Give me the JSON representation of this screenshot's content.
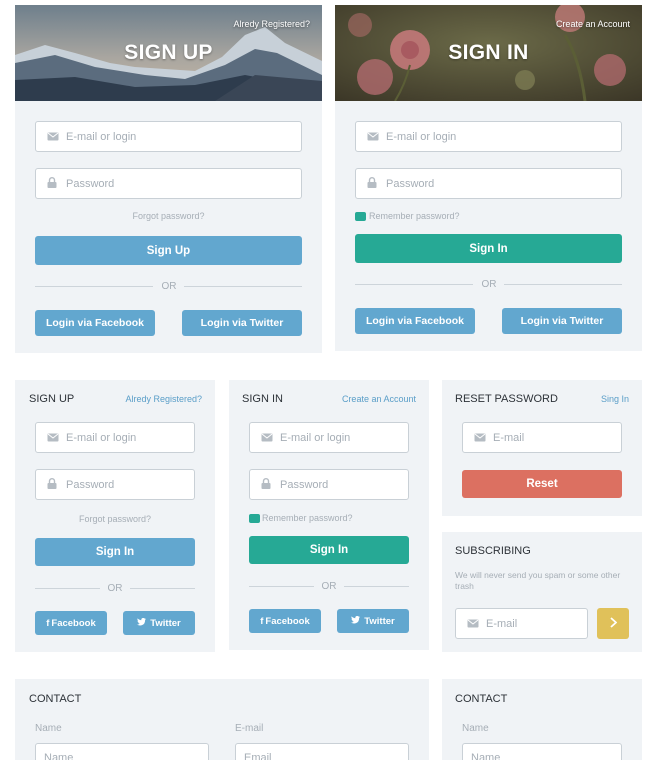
{
  "signup_large": {
    "title": "SIGN UP",
    "top_link": "Alredy Registered?",
    "email_placeholder": "E-mail or login",
    "password_placeholder": "Password",
    "forgot": "Forgot password?",
    "submit": "Sign Up",
    "or": "OR",
    "facebook": "Login via Facebook",
    "twitter": "Login via Twitter"
  },
  "signin_large": {
    "title": "SIGN IN",
    "top_link": "Create an Account",
    "email_placeholder": "E-mail or login",
    "password_placeholder": "Password",
    "remember": "Remember password?",
    "submit": "Sign In",
    "or": "OR",
    "facebook": "Login via Facebook",
    "twitter": "Login via Twitter"
  },
  "signup_small": {
    "title": "SIGN UP",
    "top_link": "Alredy Registered?",
    "email_placeholder": "E-mail or login",
    "password_placeholder": "Password",
    "forgot": "Forgot password?",
    "submit": "Sign In",
    "or": "OR",
    "facebook": "Facebook",
    "twitter": "Twitter"
  },
  "signin_small": {
    "title": "SIGN IN",
    "top_link": "Create an Account",
    "email_placeholder": "E-mail or login",
    "password_placeholder": "Password",
    "remember": "Remember password?",
    "submit": "Sign In",
    "or": "OR",
    "facebook": "Facebook",
    "twitter": "Twitter"
  },
  "reset": {
    "title": "RESET PASSWORD",
    "top_link": "Sing In",
    "email_placeholder": "E-mail",
    "submit": "Reset"
  },
  "subscribe": {
    "title": "SUBSCRIBING",
    "note": "We will never send you spam or some other trash",
    "email_placeholder": "E-mail"
  },
  "contact_wide": {
    "title": "CONTACT",
    "name_label": "Name",
    "name_placeholder": "Name",
    "email_label": "E-mail",
    "email_placeholder": "Email"
  },
  "contact_narrow": {
    "title": "CONTACT",
    "name_label": "Name",
    "name_placeholder": "Name"
  },
  "colors": {
    "card_bg": "#f0f3f6",
    "blue": "#62a7cf",
    "green": "#26a995",
    "red": "#dc7061",
    "yellow": "#e0c15a"
  }
}
